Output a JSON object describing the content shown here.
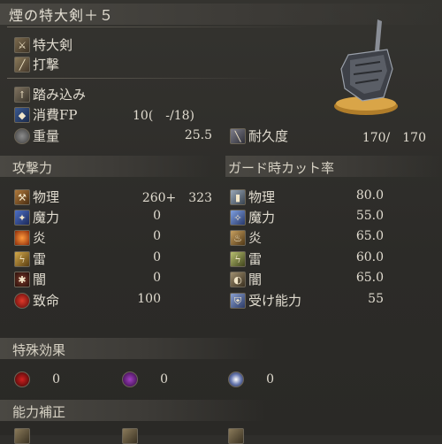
{
  "weapon_title": "煙の特大剣＋５",
  "info": {
    "weapon_type": "特大剣",
    "attack_type": "打撃",
    "skill": "踏み込み",
    "fp_label": "消費FP",
    "fp_value": "10(　-/18)",
    "weight_label": "重量",
    "weight_value": "25.5",
    "durability_label": "耐久度",
    "durability_value": "170/　170"
  },
  "attack": {
    "header": "攻撃力",
    "rows": [
      {
        "label": "物理",
        "value": "260+　323",
        "icon": "physical-attack-icon"
      },
      {
        "label": "魔力",
        "value": "0",
        "icon": "magic-attack-icon"
      },
      {
        "label": "炎",
        "value": "0",
        "icon": "fire-attack-icon"
      },
      {
        "label": "雷",
        "value": "0",
        "icon": "lightning-attack-icon"
      },
      {
        "label": "闇",
        "value": "0",
        "icon": "dark-attack-icon"
      },
      {
        "label": "致命",
        "value": "100",
        "icon": "critical-icon"
      }
    ]
  },
  "guard": {
    "header": "ガード時カット率",
    "rows": [
      {
        "label": "物理",
        "value": "80.0",
        "icon": "physical-guard-icon"
      },
      {
        "label": "魔力",
        "value": "55.0",
        "icon": "magic-guard-icon"
      },
      {
        "label": "炎",
        "value": "65.0",
        "icon": "fire-guard-icon"
      },
      {
        "label": "雷",
        "value": "60.0",
        "icon": "lightning-guard-icon"
      },
      {
        "label": "闇",
        "value": "65.0",
        "icon": "dark-guard-icon"
      },
      {
        "label": "受け能力",
        "value": "55",
        "icon": "stability-icon"
      }
    ]
  },
  "special": {
    "header": "特殊効果",
    "effects": [
      {
        "icon": "bleed-icon",
        "value": "0"
      },
      {
        "icon": "poison-icon",
        "value": "0"
      },
      {
        "icon": "frost-icon",
        "value": "0"
      }
    ]
  },
  "scaling": {
    "header": "能力補正"
  }
}
